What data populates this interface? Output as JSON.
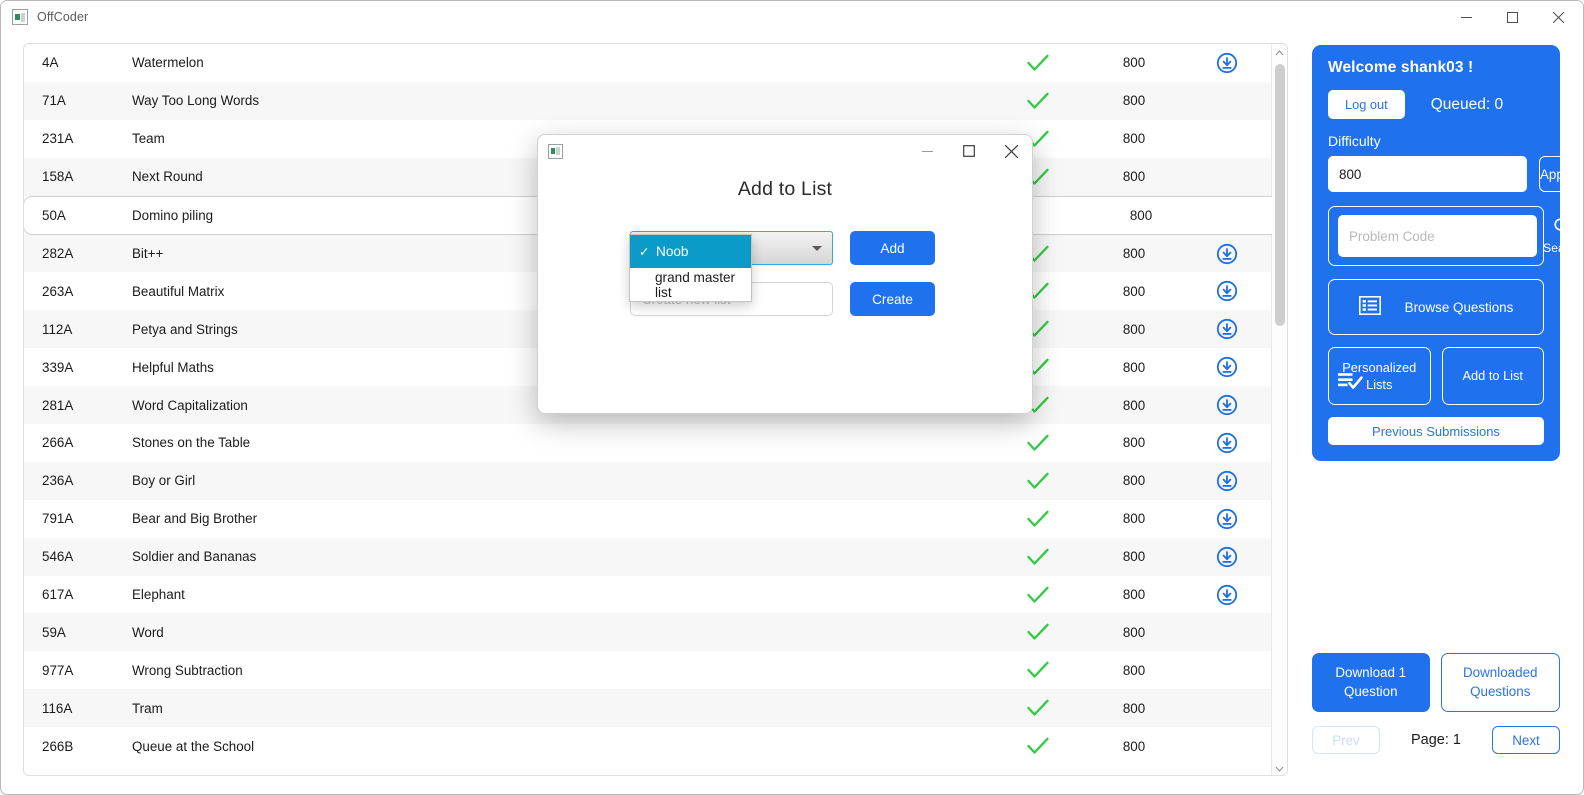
{
  "window": {
    "title": "OffCoder",
    "app_icon": "app-logo-icon",
    "controls": {
      "minimize": "minimize-icon",
      "maximize": "maximize-icon",
      "close": "close-icon"
    }
  },
  "table": {
    "rows": [
      {
        "code": "4A",
        "name": "Watermelon",
        "solved": true,
        "rating": "800",
        "download": true,
        "selected": false
      },
      {
        "code": "71A",
        "name": "Way Too Long Words",
        "solved": true,
        "rating": "800",
        "download": false,
        "selected": false
      },
      {
        "code": "231A",
        "name": "Team",
        "solved": true,
        "rating": "800",
        "download": false,
        "selected": false
      },
      {
        "code": "158A",
        "name": "Next Round",
        "solved": true,
        "rating": "800",
        "download": false,
        "selected": false
      },
      {
        "code": "50A",
        "name": "Domino piling",
        "solved": false,
        "rating": "800",
        "download": false,
        "selected": true
      },
      {
        "code": "282A",
        "name": "Bit++",
        "solved": true,
        "rating": "800",
        "download": true,
        "selected": false
      },
      {
        "code": "263A",
        "name": "Beautiful Matrix",
        "solved": true,
        "rating": "800",
        "download": true,
        "selected": false
      },
      {
        "code": "112A",
        "name": "Petya and Strings",
        "solved": true,
        "rating": "800",
        "download": true,
        "selected": false
      },
      {
        "code": "339A",
        "name": "Helpful Maths",
        "solved": true,
        "rating": "800",
        "download": true,
        "selected": false
      },
      {
        "code": "281A",
        "name": "Word Capitalization",
        "solved": true,
        "rating": "800",
        "download": true,
        "selected": false
      },
      {
        "code": "266A",
        "name": "Stones on the Table",
        "solved": true,
        "rating": "800",
        "download": true,
        "selected": false
      },
      {
        "code": "236A",
        "name": "Boy or Girl",
        "solved": true,
        "rating": "800",
        "download": true,
        "selected": false
      },
      {
        "code": "791A",
        "name": "Bear and Big Brother",
        "solved": true,
        "rating": "800",
        "download": true,
        "selected": false
      },
      {
        "code": "546A",
        "name": "Soldier and Bananas",
        "solved": true,
        "rating": "800",
        "download": true,
        "selected": false
      },
      {
        "code": "617A",
        "name": "Elephant",
        "solved": true,
        "rating": "800",
        "download": true,
        "selected": false
      },
      {
        "code": "59A",
        "name": "Word",
        "solved": true,
        "rating": "800",
        "download": false,
        "selected": false
      },
      {
        "code": "977A",
        "name": "Wrong Subtraction",
        "solved": true,
        "rating": "800",
        "download": false,
        "selected": false
      },
      {
        "code": "116A",
        "name": "Tram",
        "solved": true,
        "rating": "800",
        "download": false,
        "selected": false
      },
      {
        "code": "266B",
        "name": "Queue at the School",
        "solved": true,
        "rating": "800",
        "download": false,
        "selected": false
      }
    ],
    "scrollbar": {
      "up_arrow": "chevron-up-icon",
      "down_arrow": "chevron-down-icon"
    }
  },
  "sidebar": {
    "welcome": "Welcome shank03 !",
    "logout_label": "Log out",
    "queued_label": "Queued: 0",
    "difficulty_label": "Difficulty",
    "difficulty_value": "800",
    "apply_label": "Apply",
    "search_placeholder": "Problem Code",
    "search_value": "",
    "search_label": "Search",
    "search_icon": "search-icon",
    "browse_label": "Browse Questions",
    "browse_icon": "list-view-icon",
    "personalized_label": "Personalized\nLists",
    "personalized_line1": "Personalized",
    "personalized_line2": "Lists",
    "personalized_icon": "list-check-icon",
    "add_to_list_label": "Add to List",
    "previous_submissions_label": "Previous Submissions",
    "accent_color": "#1f71ee",
    "accent_text_color": "#2b73e8"
  },
  "bottom": {
    "download_line1": "Download 1",
    "download_line2": "Question",
    "downloaded_line1": "Downloaded",
    "downloaded_line2": "Questions",
    "prev_label": "Prev",
    "page_label": "Page: 1",
    "next_label": "Next"
  },
  "modal": {
    "icon": "app-logo-icon",
    "title": "Add to List",
    "controls": {
      "minimize": "minimize-icon",
      "maximize": "maximize-icon",
      "close": "close-icon"
    },
    "combobox": {
      "selected": "Noob",
      "caret_icon": "chevron-down-icon",
      "options": [
        {
          "label": "Noob",
          "selected": true
        },
        {
          "label": "grand master list",
          "selected": false
        }
      ],
      "tick": "✓"
    },
    "add_label": "Add",
    "new_list_placeholder": "Create new list",
    "new_list_value": "",
    "create_label": "Create"
  },
  "colors": {
    "accent_blue": "#1f71ee",
    "dropdown_highlight": "#0b9bc8",
    "check_green": "#2ecc40",
    "focus_cyan": "#2aaede"
  }
}
